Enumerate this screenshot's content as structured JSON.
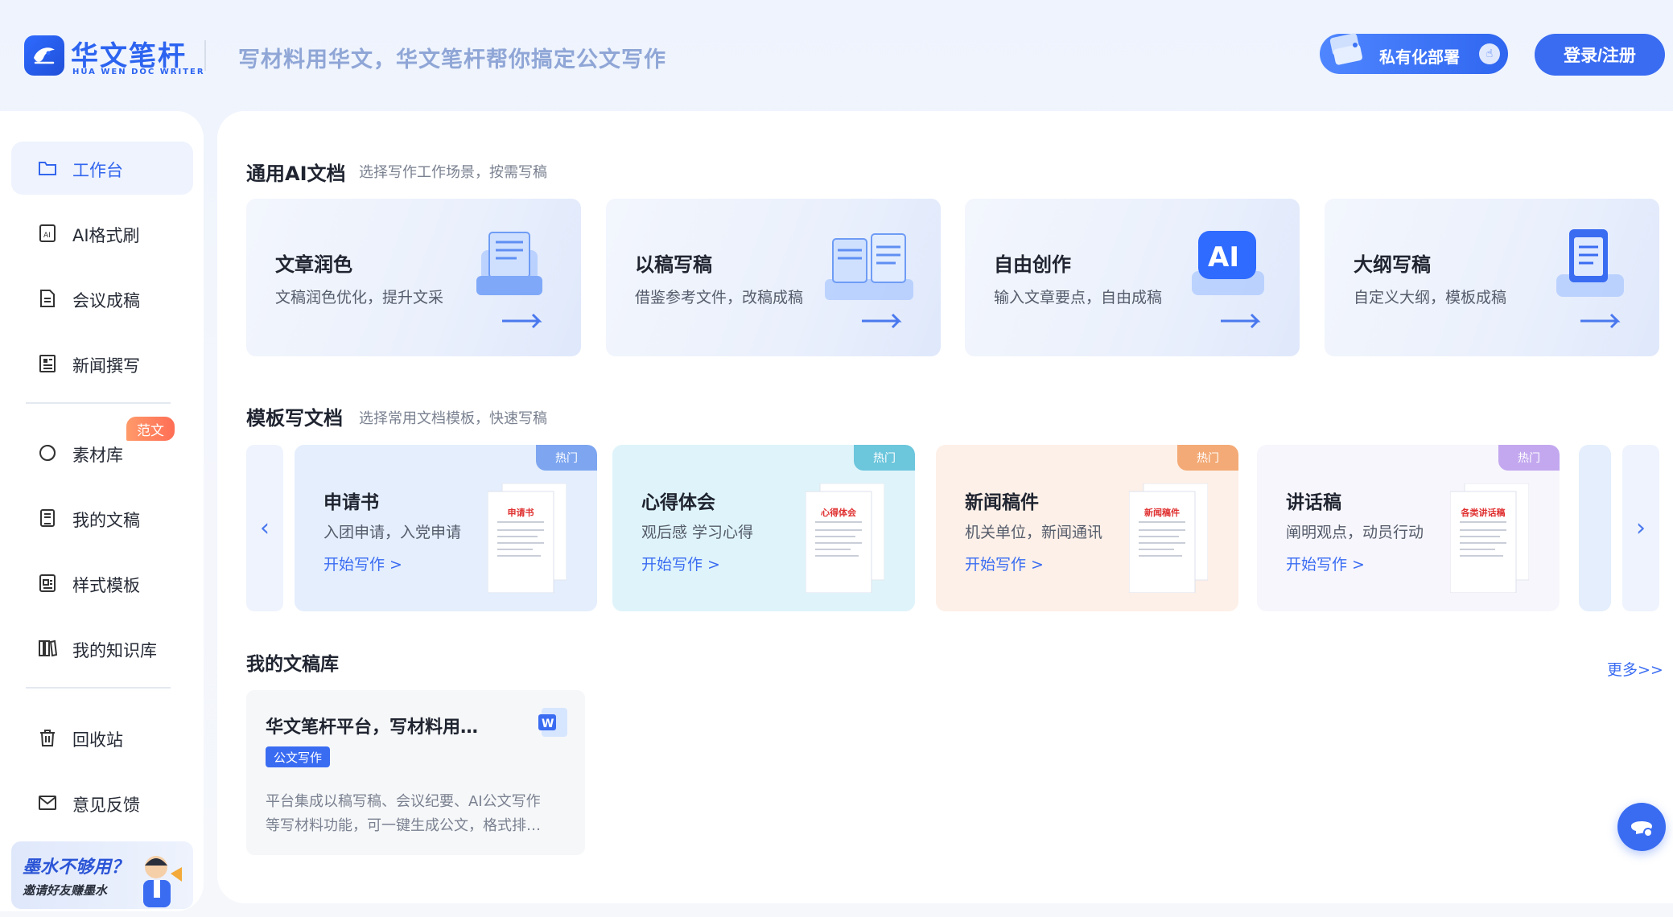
{
  "brand": {
    "name": "华文笔杆",
    "sub": "HUA WEN DOC WRITER",
    "slogan": "写材料用华文，华文笔杆帮你搞定公文写作"
  },
  "header": {
    "private_label": "私有化部署",
    "login_label": "登录/注册"
  },
  "sidebar": {
    "items": [
      {
        "label": "工作台",
        "icon": "folder-icon",
        "active": true
      },
      {
        "label": "AI格式刷",
        "icon": "ai-doc-icon"
      },
      {
        "label": "会议成稿",
        "icon": "document-icon"
      },
      {
        "label": "新闻撰写",
        "icon": "news-icon"
      },
      {
        "label": "素材库",
        "icon": "material-icon",
        "badge": "范文"
      },
      {
        "label": "我的文稿",
        "icon": "manuscript-icon"
      },
      {
        "label": "样式模板",
        "icon": "template-icon"
      },
      {
        "label": "我的知识库",
        "icon": "library-icon"
      },
      {
        "label": "回收站",
        "icon": "trash-icon"
      },
      {
        "label": "意见反馈",
        "icon": "feedback-icon"
      }
    ],
    "invite_title": "墨水不够用？",
    "invite_sub": "邀请好友赚墨水"
  },
  "ai_docs": {
    "title": "通用AI文档",
    "subtitle": "选择写作工作场景，按需写稿",
    "cards": [
      {
        "title": "文章润色",
        "desc": "文稿润色优化，提升文采"
      },
      {
        "title": "以稿写稿",
        "desc": "借鉴参考文件，改稿成稿"
      },
      {
        "title": "自由创作",
        "desc": "输入文章要点，自由成稿"
      },
      {
        "title": "大纲写稿",
        "desc": "自定义大纲，模板成稿"
      }
    ]
  },
  "templates": {
    "title": "模板写文档",
    "subtitle": "选择常用文档模板，快速写稿",
    "hot_label": "热门",
    "start_label": "开始写作 >",
    "cards": [
      {
        "title": "申请书",
        "desc": "入团申请，入党申请",
        "doc_head": "申请书",
        "bg": "#e4eefc",
        "hot_color": "#7ea6f0"
      },
      {
        "title": "心得体会",
        "desc": "观后感 学习心得",
        "doc_head": "心得体会",
        "bg": "#dff4fa",
        "hot_color": "#6cc6dc"
      },
      {
        "title": "新闻稿件",
        "desc": "机关单位，新闻通讯",
        "doc_head": "新闻稿件",
        "bg": "#fdf0e8",
        "hot_color": "#f3aa76"
      },
      {
        "title": "讲话稿",
        "desc": "阐明观点，动员行动",
        "doc_head": "各类讲话稿",
        "bg": "#f7f6fc",
        "hot_color": "#c3a8ef"
      }
    ]
  },
  "library": {
    "title": "我的文稿库",
    "more_label": "更多>>",
    "card": {
      "title": "华文笔杆平台，写材料用…",
      "tag": "公文写作",
      "desc_line1": "平台集成以稿写稿、会议纪要、AI公文写作",
      "desc_line2": "等写材料功能，可一键生成公文，格式排…"
    }
  },
  "colors": {
    "accent": "#3a6cf2",
    "badge": "#ff7a5c"
  }
}
